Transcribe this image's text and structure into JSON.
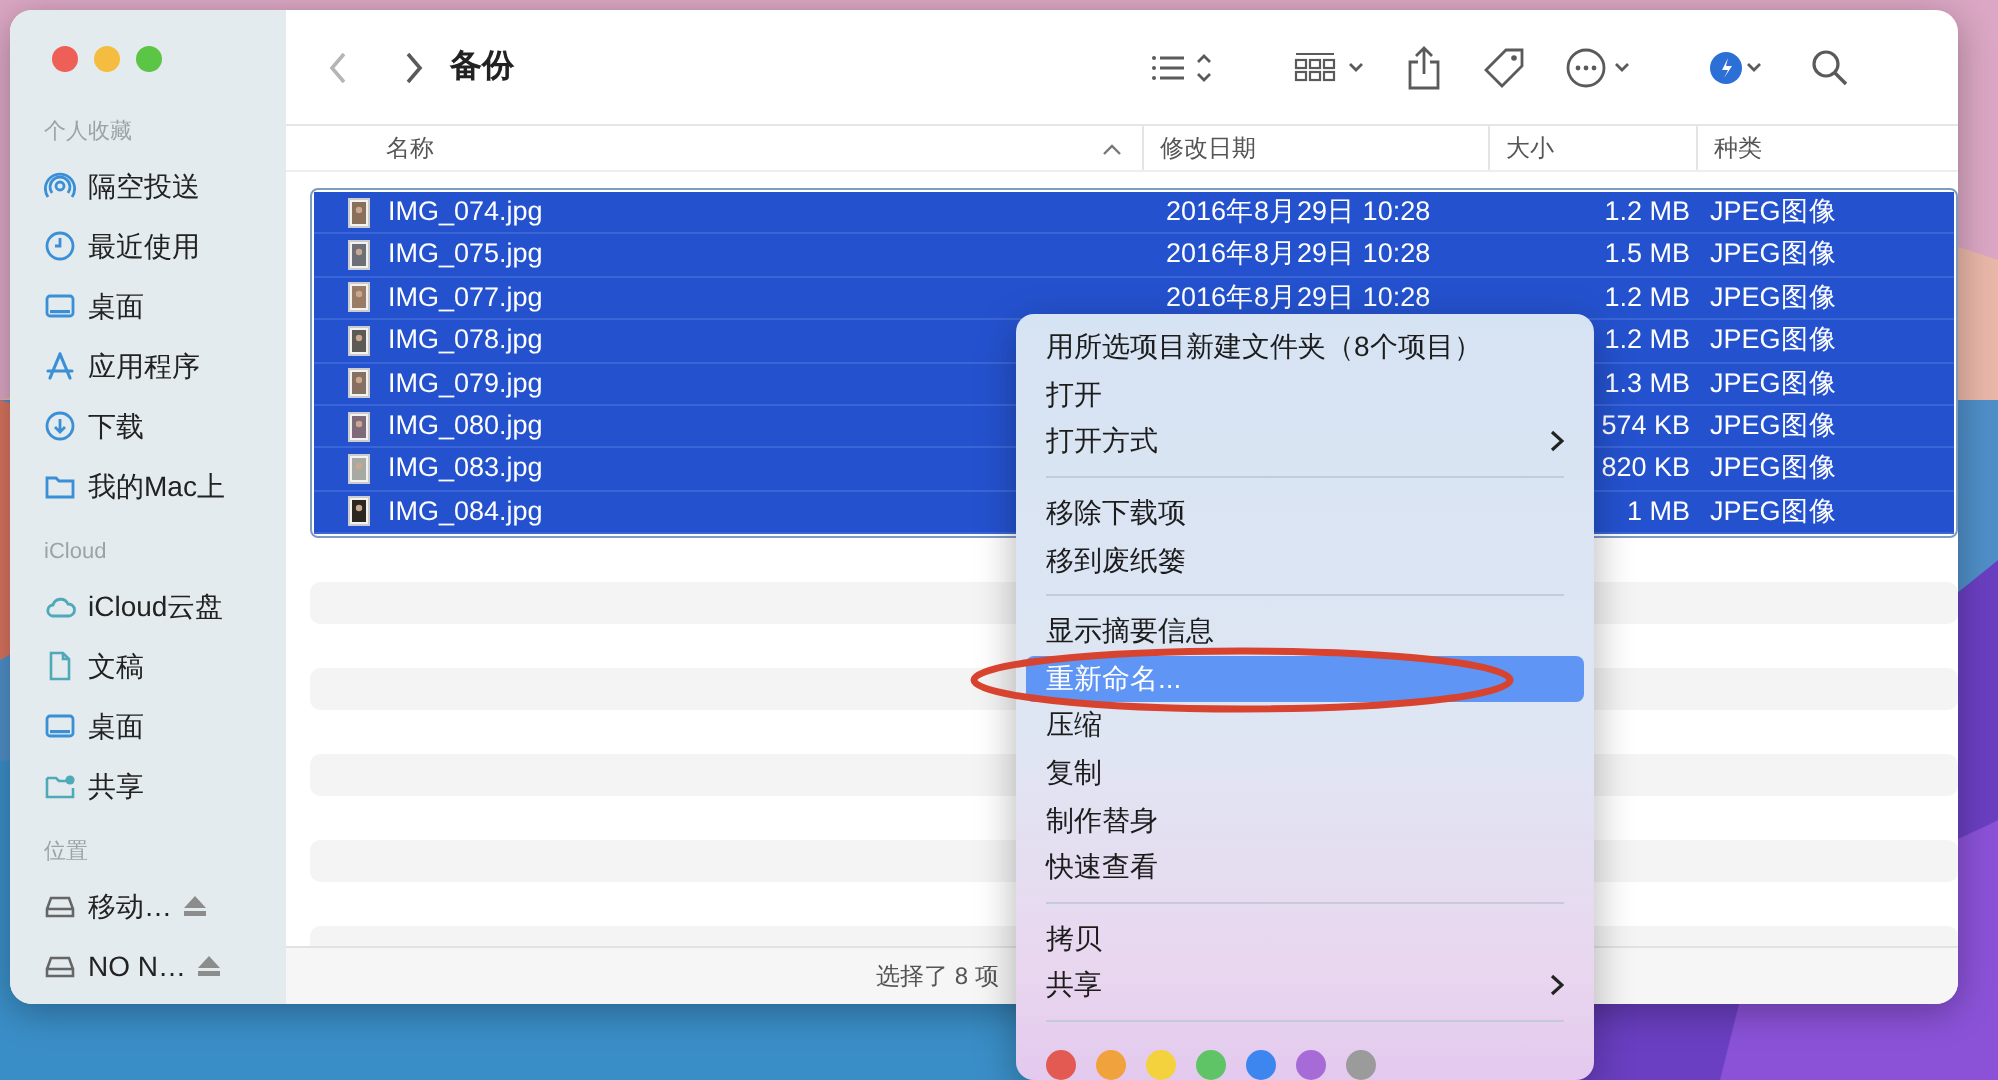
{
  "window": {
    "title": "备份"
  },
  "sidebar": {
    "sections": [
      {
        "heading": "个人收藏",
        "items": [
          {
            "label": "隔空投送",
            "kind": "airdrop"
          },
          {
            "label": "最近使用",
            "kind": "recent"
          },
          {
            "label": "桌面",
            "kind": "desktop"
          },
          {
            "label": "应用程序",
            "kind": "apps"
          },
          {
            "label": "下载",
            "kind": "downloads"
          },
          {
            "label": "我的Mac上",
            "kind": "folder"
          }
        ]
      },
      {
        "heading": "iCloud",
        "items": [
          {
            "label": "iCloud云盘",
            "kind": "cloud"
          },
          {
            "label": "文稿",
            "kind": "document"
          },
          {
            "label": "桌面",
            "kind": "desktop"
          },
          {
            "label": "共享",
            "kind": "shared"
          }
        ]
      },
      {
        "heading": "位置",
        "items": [
          {
            "label": "移动…",
            "kind": "drive",
            "ejectable": true
          },
          {
            "label": "NO N…",
            "kind": "drive",
            "ejectable": true
          }
        ]
      }
    ]
  },
  "table": {
    "columns": [
      {
        "label": "名称",
        "sorted": true
      },
      {
        "label": "修改日期",
        "sorted": false
      },
      {
        "label": "大小",
        "sorted": false
      },
      {
        "label": "种类",
        "sorted": false
      }
    ],
    "rows": [
      {
        "name": "IMG_074.jpg",
        "date": "2016年8月29日 10:28",
        "size": "1.2 MB",
        "kind": "JPEG图像",
        "selected": true
      },
      {
        "name": "IMG_075.jpg",
        "date": "2016年8月29日 10:28",
        "size": "1.5 MB",
        "kind": "JPEG图像",
        "selected": true
      },
      {
        "name": "IMG_077.jpg",
        "date": "2016年8月29日 10:28",
        "size": "1.2 MB",
        "kind": "JPEG图像",
        "selected": true
      },
      {
        "name": "IMG_078.jpg",
        "size": "1.2 MB",
        "kind": "JPEG图像",
        "selected": true
      },
      {
        "name": "IMG_079.jpg",
        "size": "1.3 MB",
        "kind": "JPEG图像",
        "selected": true
      },
      {
        "name": "IMG_080.jpg",
        "size": "574 KB",
        "kind": "JPEG图像",
        "selected": true
      },
      {
        "name": "IMG_083.jpg",
        "size": "820 KB",
        "kind": "JPEG图像",
        "selected": true
      },
      {
        "name": "IMG_084.jpg",
        "size": "1 MB",
        "kind": "JPEG图像",
        "selected": true
      }
    ]
  },
  "status_bar": "选择了 8 项",
  "context_menu": {
    "items": [
      {
        "kind": "item",
        "label": "用所选项目新建文件夹（8个项目）",
        "selected": false,
        "submenu": false
      },
      {
        "kind": "item",
        "label": "打开",
        "selected": false,
        "submenu": false
      },
      {
        "kind": "item",
        "label": "打开方式",
        "selected": false,
        "submenu": true
      },
      {
        "kind": "separator"
      },
      {
        "kind": "item",
        "label": "移除下载项",
        "selected": false,
        "submenu": false
      },
      {
        "kind": "item",
        "label": "移到废纸篓",
        "selected": false,
        "submenu": false
      },
      {
        "kind": "separator"
      },
      {
        "kind": "item",
        "label": "显示摘要信息",
        "selected": false,
        "submenu": false
      },
      {
        "kind": "item",
        "label": "重新命名...",
        "selected": true,
        "submenu": false
      },
      {
        "kind": "item",
        "label": "压缩",
        "selected": false,
        "submenu": false
      },
      {
        "kind": "item",
        "label": "复制",
        "selected": false,
        "submenu": false
      },
      {
        "kind": "item",
        "label": "制作替身",
        "selected": false,
        "submenu": false
      },
      {
        "kind": "item",
        "label": "快速查看",
        "selected": false,
        "submenu": false
      },
      {
        "kind": "separator"
      },
      {
        "kind": "item",
        "label": "拷贝",
        "selected": false,
        "submenu": false
      },
      {
        "kind": "item",
        "label": "共享",
        "selected": false,
        "submenu": true
      },
      {
        "kind": "separator"
      },
      {
        "kind": "tags",
        "tags": [
          {
            "color": "#e35a52"
          },
          {
            "color": "#f0a33c"
          },
          {
            "color": "#f3d23d"
          },
          {
            "color": "#5fc465"
          },
          {
            "color": "#3e86ef"
          },
          {
            "color": "#a66bd6"
          },
          {
            "color": "#9b9b9b"
          }
        ]
      }
    ]
  },
  "annotation": {
    "kind": "ellipse"
  }
}
